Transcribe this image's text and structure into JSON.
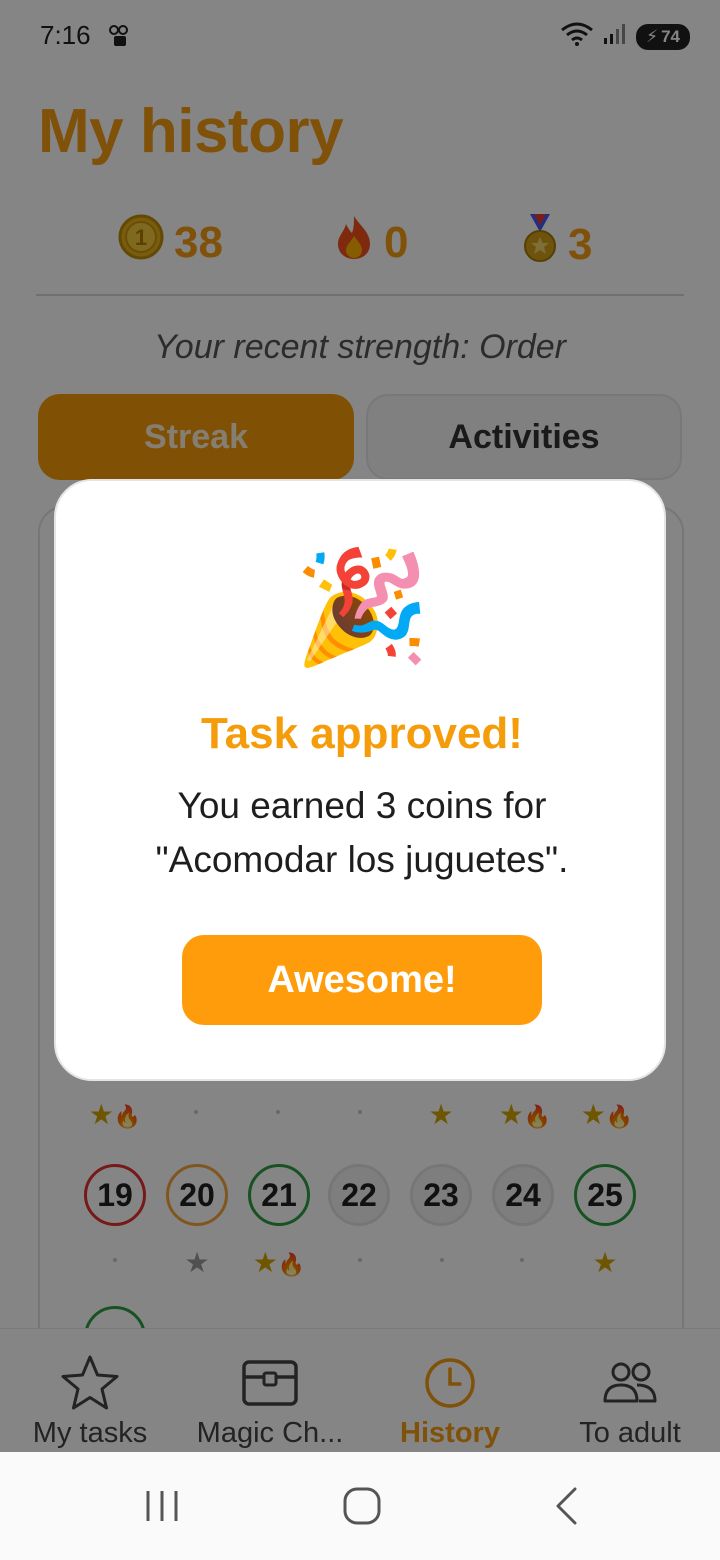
{
  "status_bar": {
    "time": "7:16",
    "battery": "74"
  },
  "header": {
    "title": "My history"
  },
  "stats": {
    "coins": "38",
    "streak": "0",
    "medals": "3"
  },
  "strength": "Your recent strength: Order",
  "tabs": {
    "streak": "Streak",
    "activities": "Activities"
  },
  "calendar": {
    "days": [
      "19",
      "20",
      "21",
      "22",
      "23",
      "24",
      "25"
    ]
  },
  "modal": {
    "emoji": "🎉",
    "title": "Task approved!",
    "message": "You earned 3 coins for \"Acomodar los juguetes\".",
    "button": "Awesome!"
  },
  "bottom_nav": {
    "items": [
      {
        "label": "My tasks",
        "icon": "star-outline-icon"
      },
      {
        "label": "Magic Ch...",
        "icon": "treasure-chest-icon"
      },
      {
        "label": "History",
        "icon": "clock-icon"
      },
      {
        "label": "To adult",
        "icon": "people-icon"
      }
    ],
    "active": "History"
  },
  "colors": {
    "accent": "#f39c12",
    "button": "#ff9c0b",
    "overlay": "rgba(0,0,0,0.48)"
  }
}
